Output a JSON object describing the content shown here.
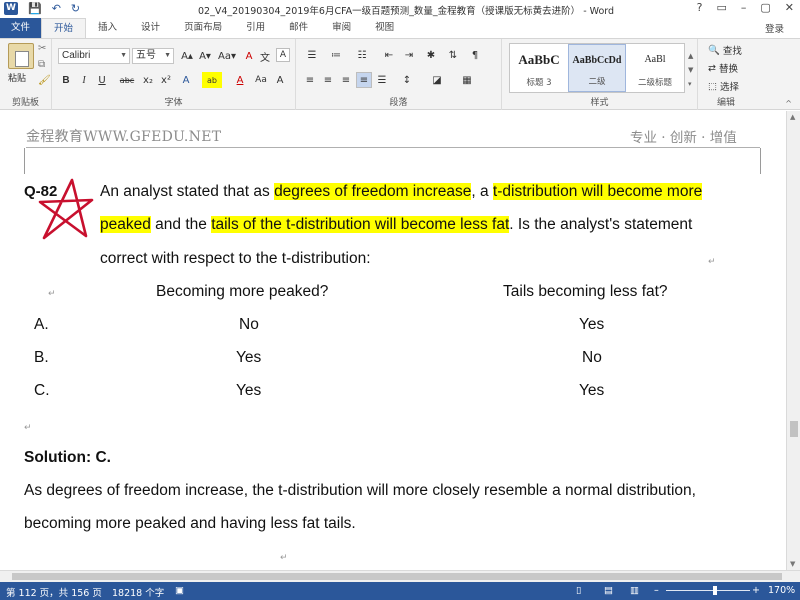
{
  "title_bar": {
    "title": "02_V4_20190304_2019年6月CFA一级百题预测_数量_金程教育（授课版无标黄去进阶） - Word",
    "quick_access": [
      "W",
      "💾",
      "↶",
      "↻"
    ],
    "window_controls": [
      "?",
      "▭",
      "–",
      "▢",
      "✕"
    ]
  },
  "ribbon_tabs": {
    "items": [
      "文件",
      "开始",
      "插入",
      "设计",
      "页面布局",
      "引用",
      "邮件",
      "审阅",
      "视图"
    ],
    "active": "开始",
    "login": "登录"
  },
  "ribbon": {
    "clipboard": {
      "label": "剪贴板",
      "paste": "粘贴"
    },
    "font": {
      "label": "字体",
      "font_name": "Calibri",
      "font_size": "五号",
      "buttons_row1": [
        "A▴",
        "A▾",
        "Aa▾",
        "A",
        "文",
        "A"
      ],
      "buttons_row2": [
        "B",
        "I",
        "U",
        "abc",
        "x₂",
        "x²",
        "A",
        "ab",
        "A",
        "Aa",
        "A",
        "字"
      ]
    },
    "paragraph": {
      "label": "段落"
    },
    "styles": {
      "label": "样式",
      "items": [
        {
          "preview": "AaBbC",
          "name": "标题 3"
        },
        {
          "preview": "AaBbCcDd",
          "name": "二级"
        },
        {
          "preview": "AaBl",
          "name": "二级标题"
        }
      ]
    },
    "editing": {
      "label": "编辑",
      "find": "查找",
      "replace": "替换",
      "select": "选择"
    }
  },
  "document": {
    "header_left": "金程教育WWW.GFEDU.NET",
    "header_right": "专业 · 创新 · 增值",
    "question_number": "Q-82",
    "question_line1": {
      "pre": "An analyst stated that as ",
      "hl1": "degrees of freedom increase",
      "mid": ", a ",
      "hl2": "t-distribution will become more"
    },
    "question_line2": {
      "hl1": "peaked",
      "mid": " and the ",
      "hl2": "tails of the t-distribution will become less fat",
      "post": ". Is the analyst's statement"
    },
    "question_line3": "correct with respect to the t-distribution:",
    "table": {
      "col1_header": "Becoming more peaked?",
      "col2_header": "Tails becoming less fat?",
      "rows": [
        {
          "option": "A.",
          "col1": "No",
          "col2": "Yes"
        },
        {
          "option": "B.",
          "col1": "Yes",
          "col2": "No"
        },
        {
          "option": "C.",
          "col1": "Yes",
          "col2": "Yes"
        }
      ]
    },
    "solution_label": "Solution: C.",
    "solution_line1": "As degrees of freedom increase, the t-distribution will more closely resemble a normal distribution,",
    "solution_line2": "becoming more peaked and having less fat tails."
  },
  "status_bar": {
    "page": "第 112 页，共 156 页",
    "words": "18218 个字",
    "zoom": "170%"
  },
  "colors": {
    "accent": "#2b579a",
    "highlight": "#ffff00",
    "star": "#c8102e"
  }
}
